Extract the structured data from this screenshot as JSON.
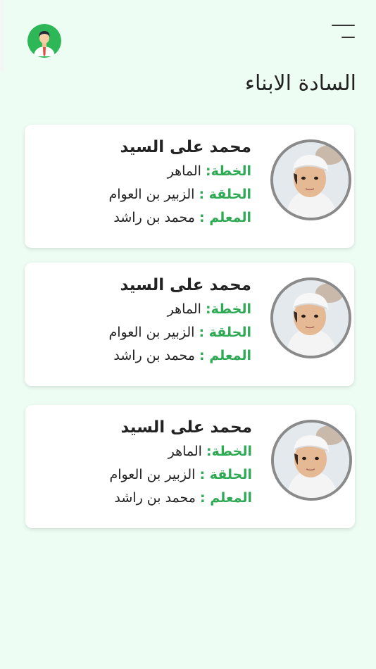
{
  "header": {
    "title": "السادة الابناء"
  },
  "colors": {
    "background": "#edfdf3",
    "label_green": "#2eaa55",
    "card": "#ffffff"
  },
  "children": [
    {
      "name": "محمد على السيد",
      "plan_label": "الخطة:",
      "plan_value": "الماهر",
      "circle_label": "الحلقة :",
      "circle_value": "الزبير بن العوام",
      "teacher_label": "المعلم :",
      "teacher_value": "محمد بن راشد"
    },
    {
      "name": "محمد على السيد",
      "plan_label": "الخطة:",
      "plan_value": "الماهر",
      "circle_label": "الحلقة :",
      "circle_value": "الزبير بن العوام",
      "teacher_label": "المعلم :",
      "teacher_value": "محمد بن راشد"
    },
    {
      "name": "محمد على السيد",
      "plan_label": "الخطة:",
      "plan_value": "الماهر",
      "circle_label": "الحلقة :",
      "circle_value": "الزبير بن العوام",
      "teacher_label": "المعلم :",
      "teacher_value": "محمد بن راشد"
    }
  ]
}
